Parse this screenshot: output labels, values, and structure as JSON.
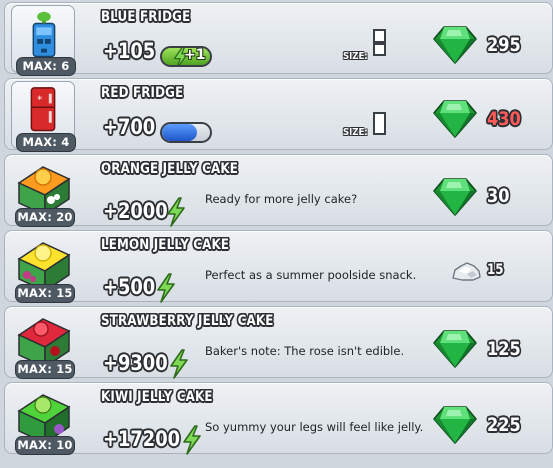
{
  "colors": {
    "gem": "#2ec748",
    "bolt": "#6fcf3d",
    "unaffordable_price": "#ff5a5a"
  },
  "items": [
    {
      "name": "BLUE FRIDGE",
      "max_label": "MAX: 6",
      "bonus": "+105",
      "booster_label": "+1",
      "size_label": "SIZE:",
      "price": "295",
      "currency": "gem-icon"
    },
    {
      "name": "RED FRIDGE",
      "max_label": "MAX: 4",
      "bonus": "+700",
      "storage_level": 0.72,
      "size_label": "SIZE:",
      "price": "430",
      "currency": "gem-icon"
    },
    {
      "name": "ORANGE JELLY CAKE",
      "max_label": "MAX: 20",
      "bonus": "+2000",
      "description": "Ready for more jelly cake?",
      "price": "30",
      "currency": "gem-icon"
    },
    {
      "name": "LEMON JELLY CAKE",
      "max_label": "MAX: 15",
      "bonus": "+500",
      "description": "Perfect as a summer poolside snack.",
      "price": "15",
      "currency": "silver-nugget-icon"
    },
    {
      "name": "STRAWBERRY JELLY CAKE",
      "max_label": "MAX: 15",
      "bonus": "+9300",
      "description": "Baker's note: The rose isn't edible.",
      "price": "125",
      "currency": "gem-icon"
    },
    {
      "name": "KIWI JELLY CAKE",
      "max_label": "MAX: 10",
      "bonus": "+17200",
      "description": "So yummy your legs will feel like jelly.",
      "price": "225",
      "currency": "gem-icon"
    }
  ]
}
